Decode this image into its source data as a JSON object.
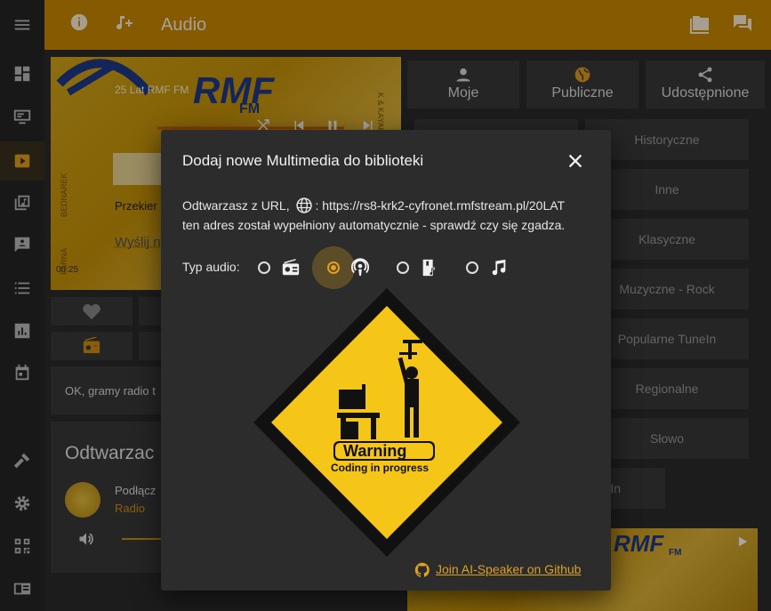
{
  "app": {
    "title": "Audio"
  },
  "sidebar": {
    "icons": [
      "menu-icon",
      "dashboard-icon",
      "monitor-icon",
      "play-icon",
      "library-music-icon",
      "chat-icon",
      "list-icon",
      "chart-icon",
      "calendar-icon",
      "hammer-icon",
      "gear-icon",
      "qrcode-icon",
      "reader-icon"
    ]
  },
  "header": {
    "icons": [
      "info-icon",
      "add-music-icon",
      "folder-icon",
      "forum-icon"
    ]
  },
  "player": {
    "station_text": "25 Lat RMF FM",
    "brand": "RMF",
    "brand_fm": "FM",
    "elapsed": "00:25",
    "partial_label": "Przekier",
    "input_placeholder": "Wyślij n",
    "status_text": "OK, gramy radio t",
    "now_playing_title": "Odtwarzac",
    "track_title": "Podłącz",
    "track_subtitle": "Radio",
    "vertical_texts": [
      "BEDNAREK",
      "FARNA",
      "K & KAYAH"
    ]
  },
  "tabs": [
    {
      "label": "Moje",
      "icon": "person-icon"
    },
    {
      "label": "Publiczne",
      "icon": "globe-icon"
    },
    {
      "label": "Udostępnione",
      "icon": "share-icon"
    }
  ],
  "categories": [
    "Historyczne",
    "Inne",
    "Klasyczne",
    "Muzyczne - Rock",
    "Popularne TuneIn",
    "Regionalne",
    "Słowo",
    "In"
  ],
  "dialog": {
    "title": "Dodaj nowe Multimedia do biblioteki",
    "url_prefix": "Odtwarzasz z URL,",
    "url": "https://rs8-krk2-cyfronet.rmfstream.pl/20LAT",
    "auto_note": "ten adres został wypełniony automatycznie - sprawdź czy się zgadza.",
    "audio_type_label": "Typ audio:",
    "audio_types": [
      {
        "icon": "radio-icon",
        "selected": false
      },
      {
        "icon": "podcast-icon",
        "selected": true
      },
      {
        "icon": "audiobook-icon",
        "selected": false
      },
      {
        "icon": "music-note-icon",
        "selected": false
      }
    ],
    "warning_title": "Warning",
    "warning_subtitle": "Coding in progress",
    "github_link": "Join AI-Speaker on Github"
  },
  "colors": {
    "accent": "#ce8a00",
    "radio_selected": "#e0a020",
    "warning_yellow": "#f5c518"
  }
}
